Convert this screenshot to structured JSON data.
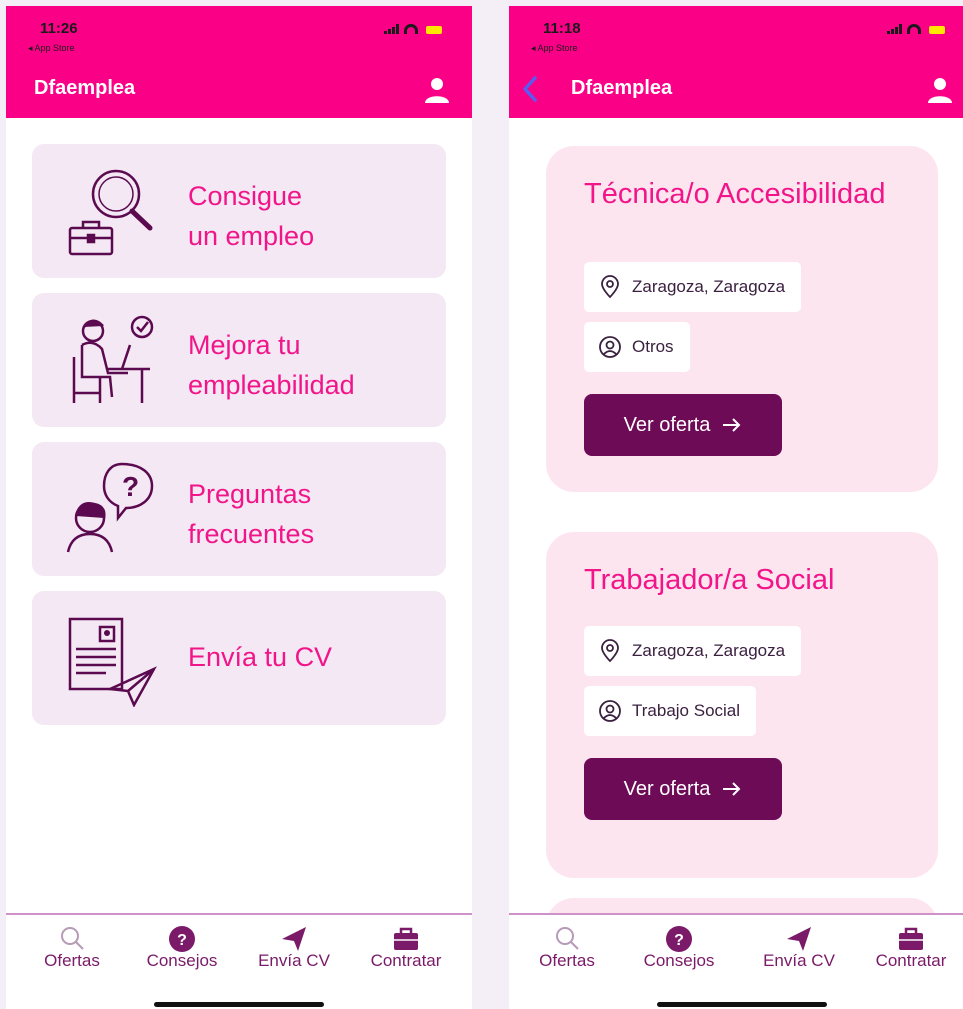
{
  "left_screen": {
    "status": {
      "time": "11:26",
      "back_app": "◂ App Store"
    },
    "header": {
      "title": "Dfaemplea",
      "user_icon": "user-icon"
    },
    "menu": [
      {
        "label": "Consigue\nun empleo",
        "icon": "job-search-icon"
      },
      {
        "label": "Mejora tu\nempleabilidad",
        "icon": "person-laptop-icon"
      },
      {
        "label": "Preguntas\nfrecuentes",
        "icon": "faq-person-icon"
      },
      {
        "label": "Envía tu CV",
        "icon": "send-cv-icon"
      }
    ],
    "tabs": [
      {
        "label": "Ofertas",
        "icon": "search-icon"
      },
      {
        "label": "Consejos",
        "icon": "help-circle-icon"
      },
      {
        "label": "Envía CV",
        "icon": "send-icon"
      },
      {
        "label": "Contratar",
        "icon": "briefcase-icon"
      }
    ]
  },
  "right_screen": {
    "status": {
      "time": "11:18",
      "back_app": "◂ App Store"
    },
    "header": {
      "title": "Dfaemplea",
      "back_icon": "chevron-left-icon",
      "user_icon": "user-icon"
    },
    "jobs": [
      {
        "title": "Técnica/o Accesibilidad",
        "location": "Zaragoza, Zaragoza",
        "category": "Otros",
        "button": "Ver oferta"
      },
      {
        "title": "Trabajador/a Social",
        "location": "Zaragoza, Zaragoza",
        "category": "Trabajo Social",
        "button": "Ver oferta"
      }
    ],
    "tabs": [
      {
        "label": "Ofertas",
        "icon": "search-icon"
      },
      {
        "label": "Consejos",
        "icon": "help-circle-icon"
      },
      {
        "label": "Envía CV",
        "icon": "send-icon"
      },
      {
        "label": "Contratar",
        "icon": "briefcase-icon"
      }
    ]
  },
  "colors": {
    "brand_pink": "#fa0087",
    "accent_text": "#f2158a",
    "menu_card_bg": "#f3e8f3",
    "job_card_bg": "#fde5ef",
    "button_bg": "#6e0b57",
    "tab_text": "#7a1a68"
  }
}
